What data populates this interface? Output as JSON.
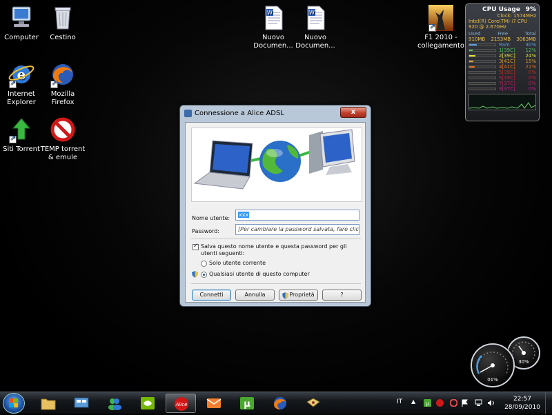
{
  "desktop": {
    "icons": [
      {
        "name": "desktop-icon-computer",
        "label": "Computer"
      },
      {
        "name": "desktop-icon-recycle-bin",
        "label": "Cestino"
      },
      {
        "name": "desktop-icon-internet-explorer",
        "label": "Internet Explorer"
      },
      {
        "name": "desktop-icon-mozilla-firefox",
        "label": "Mozilla Firefox"
      },
      {
        "name": "desktop-icon-siti-torrent",
        "label": "Siti Torrent"
      },
      {
        "name": "desktop-icon-temp-torrent",
        "label": "TEMP torrent & emule"
      },
      {
        "name": "desktop-icon-nuovo-documento-1",
        "label": "Nuovo Documen..."
      },
      {
        "name": "desktop-icon-nuovo-documento-2",
        "label": "Nuovo Documen..."
      },
      {
        "name": "desktop-icon-f1-2010",
        "label": "F1 2010 - collegamento"
      }
    ]
  },
  "cpu_gadget": {
    "title": "CPU Usage",
    "total_percent": "9%",
    "clock": "Clock: 1574MHz",
    "cpu_name": "Intel(R) Core(TM) i7 CPU 920 @ 2.67GHz",
    "mem_headers": [
      "Used",
      "Free",
      "Total"
    ],
    "mem_values": [
      "910MB",
      "2153MB",
      "3063MB"
    ],
    "rows": [
      {
        "label": "Ram",
        "pct": "30%",
        "level": 0.3,
        "color": "#5aa0e0"
      },
      {
        "label": "1[39C]",
        "pct": "12%",
        "level": 0.12,
        "color": "#50c060"
      },
      {
        "label": "2[39C]",
        "pct": "24%",
        "level": 0.24,
        "color": "#e0e040"
      },
      {
        "label": "3[41C]",
        "pct": "15%",
        "level": 0.15,
        "color": "#e0a030"
      },
      {
        "label": "4[41C]",
        "pct": "21%",
        "level": 0.21,
        "color": "#e07020"
      },
      {
        "label": "5[39C]",
        "pct": "0%",
        "level": 0,
        "color": "#c03020"
      },
      {
        "label": "6[39C]",
        "pct": "0%",
        "level": 0,
        "color": "#c02040"
      },
      {
        "label": "7[37C]",
        "pct": "0%",
        "level": 0,
        "color": "#c02060"
      },
      {
        "label": "8[37C]",
        "pct": "0%",
        "level": 0,
        "color": "#c02080"
      }
    ]
  },
  "dialog": {
    "title": "Connessione a Alice ADSL",
    "close": "x",
    "username_label": "Nome utente:",
    "username_value": "xxx",
    "password_label": "Password:",
    "password_placeholder": "[Per cambiare la password salvata, fare clic qui]",
    "save_checkbox_label": "Salva questo nome utente e questa password per gli utenti seguenti:",
    "save_checked": true,
    "option_current_user": "Solo utente corrente",
    "option_any_user": "Qualsiasi utente di questo computer",
    "buttons": {
      "connect": "Connetti",
      "cancel": "Annulla",
      "properties": "Proprietà",
      "help": "?"
    }
  },
  "meters": {
    "large": "01%",
    "small": "30%"
  },
  "taskbar": {
    "language": "IT",
    "time": "22:57",
    "date": "28/09/2010",
    "colors": {
      "accent": "#1c4f9c",
      "alice_red": "#d01818"
    }
  }
}
